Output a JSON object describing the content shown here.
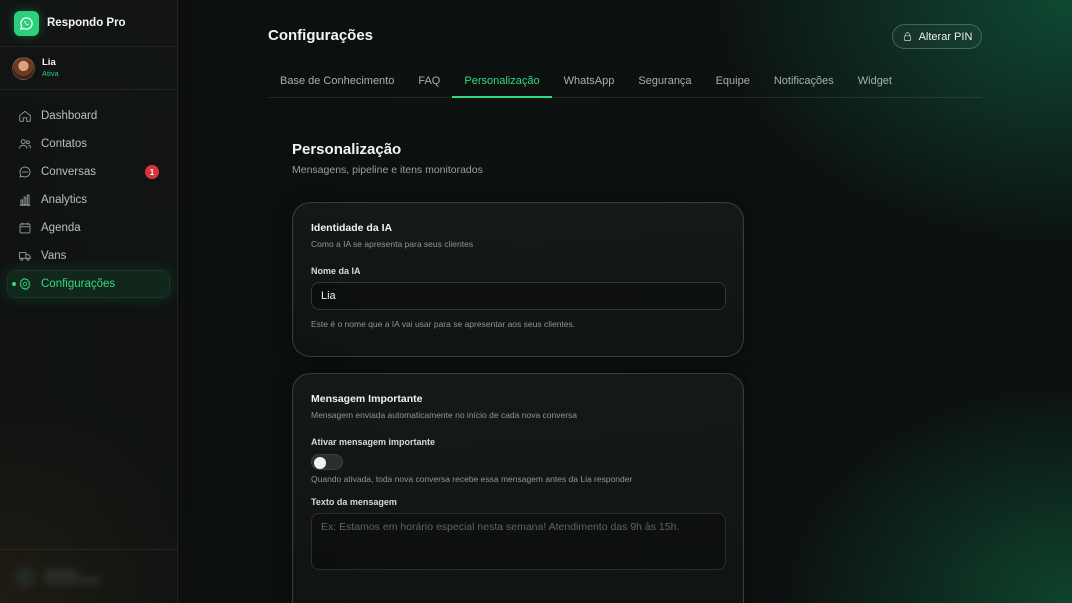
{
  "app": {
    "name": "Respondo Pro"
  },
  "user": {
    "name": "Lia",
    "status": "Ativa"
  },
  "sidebar": {
    "items": [
      {
        "label": "Dashboard",
        "icon": "home-icon"
      },
      {
        "label": "Contatos",
        "icon": "users-icon"
      },
      {
        "label": "Conversas",
        "icon": "chat-icon",
        "badge": "1"
      },
      {
        "label": "Analytics",
        "icon": "bar-chart-icon"
      },
      {
        "label": "Agenda",
        "icon": "calendar-icon"
      },
      {
        "label": "Vans",
        "icon": "truck-icon"
      },
      {
        "label": "Configurações",
        "icon": "gear-icon",
        "active": true
      }
    ]
  },
  "header": {
    "title": "Configurações",
    "pin_button": "Alterar PIN"
  },
  "tabs": [
    {
      "label": "Base de Conhecimento"
    },
    {
      "label": "FAQ"
    },
    {
      "label": "Personalização",
      "active": true
    },
    {
      "label": "WhatsApp"
    },
    {
      "label": "Segurança"
    },
    {
      "label": "Equipe"
    },
    {
      "label": "Notificações"
    },
    {
      "label": "Widget"
    }
  ],
  "section": {
    "title": "Personalização",
    "subtitle": "Mensagens, pipeline e itens monitorados"
  },
  "identity_card": {
    "title": "Identidade da IA",
    "description": "Como a IA se apresenta para seus clientes",
    "name_label": "Nome da IA",
    "name_value": "Lia",
    "hint": "Este é o nome que a IA vai usar para se apresentar aos seus clientes."
  },
  "message_card": {
    "title": "Mensagem Importante",
    "description": "Mensagem enviada automaticamente no início de cada nova conversa",
    "toggle_label": "Ativar mensagem importante",
    "toggle_on": false,
    "toggle_hint": "Quando ativada, toda nova conversa recebe essa mensagem antes da Lia responder",
    "text_label": "Texto da mensagem",
    "text_placeholder": "Ex: Estamos em horário especial nesta semana! Atendimento das 9h às 15h."
  },
  "colors": {
    "accent": "#34d87f",
    "badge": "#d8343c",
    "background": "#0b0e0d"
  }
}
